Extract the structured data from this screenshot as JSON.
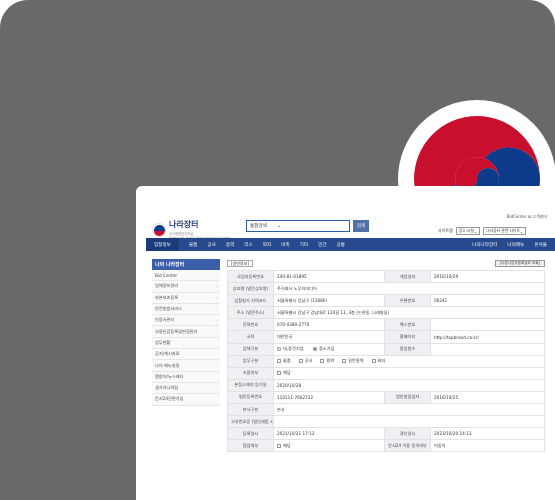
{
  "header": {
    "logo_main": "나라장터",
    "logo_sub": "국가종합전자조달",
    "logo_sub2": "Korea ON-line E-Procurement System",
    "search_scope": "통합검색",
    "search_button": "검색",
    "bidcenter_link": "BidCenter",
    "lang_link": "w:고객센터",
    "sitemap_label": "사이트맵",
    "related_site_1": "장소·시설",
    "related_site_2": "나라장터 관련 사이트"
  },
  "nav": {
    "first": "입찰정보",
    "items": [
      "물품",
      "공사",
      "용역",
      "리스",
      "외자",
      "비축",
      "기타",
      "민간",
      "공통"
    ],
    "right": [
      "나의나라장터",
      "나의메뉴",
      "온서울"
    ]
  },
  "sidebar": {
    "title": "나의 나라장터",
    "items": [
      {
        "label": "Bid Center",
        "arrow": false
      },
      {
        "label": "업체정보관리",
        "arrow": true
      },
      {
        "label": "자본보조등록",
        "arrow": true
      },
      {
        "label": "안전방범서비스",
        "arrow": true
      },
      {
        "label": "인증서관리",
        "arrow": true
      },
      {
        "label": "사용인감등록및변경관리",
        "arrow": false
      },
      {
        "label": "업무현황",
        "arrow": false
      },
      {
        "label": "공지/게시자료",
        "arrow": false
      },
      {
        "label": "나의 메뉴설정",
        "arrow": false
      },
      {
        "label": "열람이/뉴스레터",
        "arrow": false
      },
      {
        "label": "생사의나의팀",
        "arrow": false
      },
      {
        "label": "문서24간편가입",
        "arrow": false
      }
    ]
  },
  "content": {
    "tab_label": "[일반정보]",
    "top_button": "[다른사업자등록정보 조회]",
    "rows": {
      "biz_no_label": "사업자등록번호",
      "biz_no": "240-81-01895",
      "open_date_label": "개업일자",
      "open_date": "2016/10/29",
      "company_label": "상호명\n(영문상호명)",
      "company": "주식회사 노무이미디어",
      "hq_label": "입찰참가 지역코드",
      "hq": "서울특별시 강남구 (11680)",
      "zip_label": "우편번호",
      "zip": "06241",
      "address_label": "주소\n(영문주소)",
      "address": "서울특별시 강남구 강남대로 114길 11, 3층 (논현동, 나래빌딩)",
      "phone_label": "전화번호",
      "phone": "070-4380-2770",
      "fax_label": "팩스번호",
      "fax": "",
      "country_label": "국적",
      "country": "대한민국",
      "homepage_label": "홈페이지",
      "homepage": "http://topbrand.co.kr/",
      "biztype_label": "업체구분",
      "biztype_opt1": "대,중견기업",
      "biztype_opt2": "중소기업",
      "employees_label": "종업원수",
      "employees": "",
      "work_label": "업무구분",
      "work_opts": [
        "물품",
        "공사",
        "용역",
        "일반용역",
        "외자"
      ],
      "union_label": "조합여부",
      "union_opt": "해당",
      "found_label": "본점소재지 등기일",
      "found": "2020/10/28",
      "corp_no_label": "법인등록번호",
      "corp_no": "110111-7662722",
      "corp_date_label": "법인설립일자",
      "corp_date": "2016/10/25",
      "branch_label": "본사구분",
      "branch": "본사",
      "mfr_label": "고유번호증\n(법인세법 시행령)",
      "mfr": "",
      "reg_date_label": "등록일시",
      "reg_date": "2021/10/21 17:12",
      "change_label": "갱신일시",
      "change": "2023/10/20 14:13",
      "agree_label": "협업여부",
      "agree_opt": "해당",
      "doc24_label": "문서24 이용\n동의여부",
      "doc24": "미동의"
    }
  }
}
